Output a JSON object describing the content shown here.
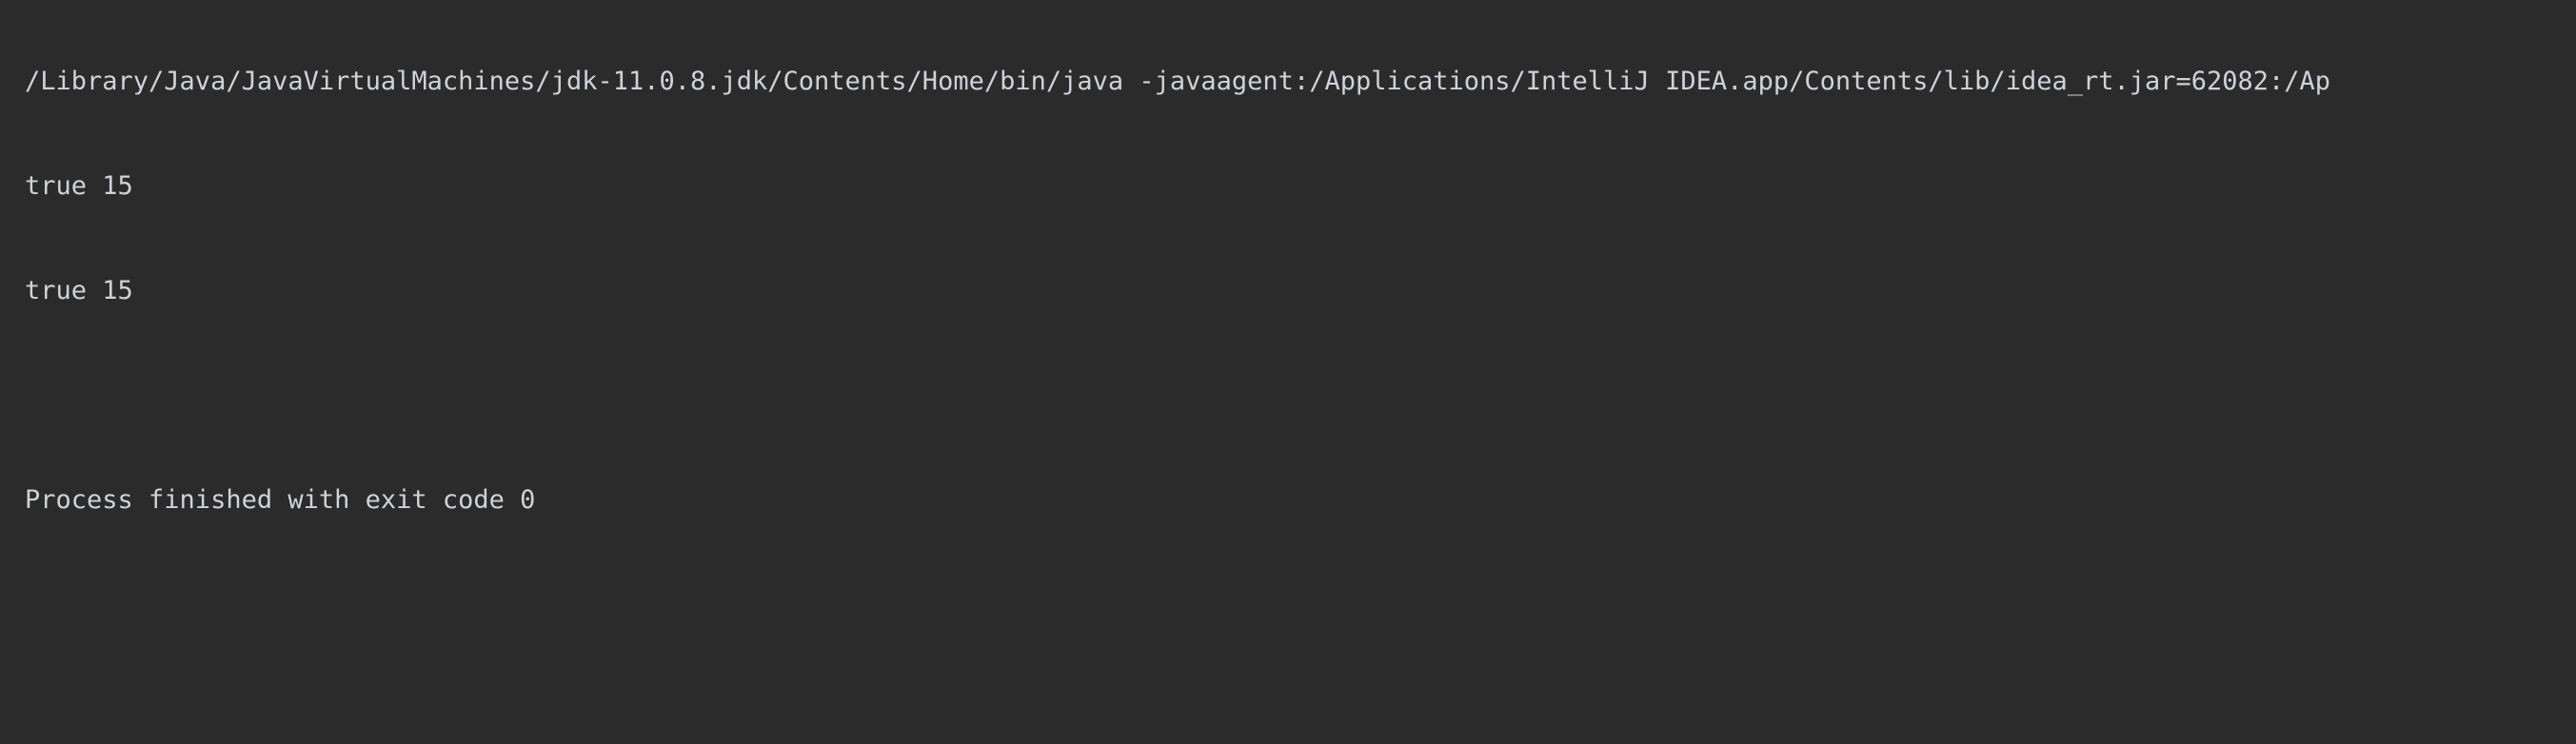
{
  "console": {
    "command_line": "/Library/Java/JavaVirtualMachines/jdk-11.0.8.jdk/Contents/Home/bin/java -javaagent:/Applications/IntelliJ IDEA.app/Contents/lib/idea_rt.jar=62082:/Ap",
    "output_lines": [
      "true 15",
      "true 15"
    ],
    "blank_line": "",
    "exit_message": "Process finished with exit code 0"
  }
}
